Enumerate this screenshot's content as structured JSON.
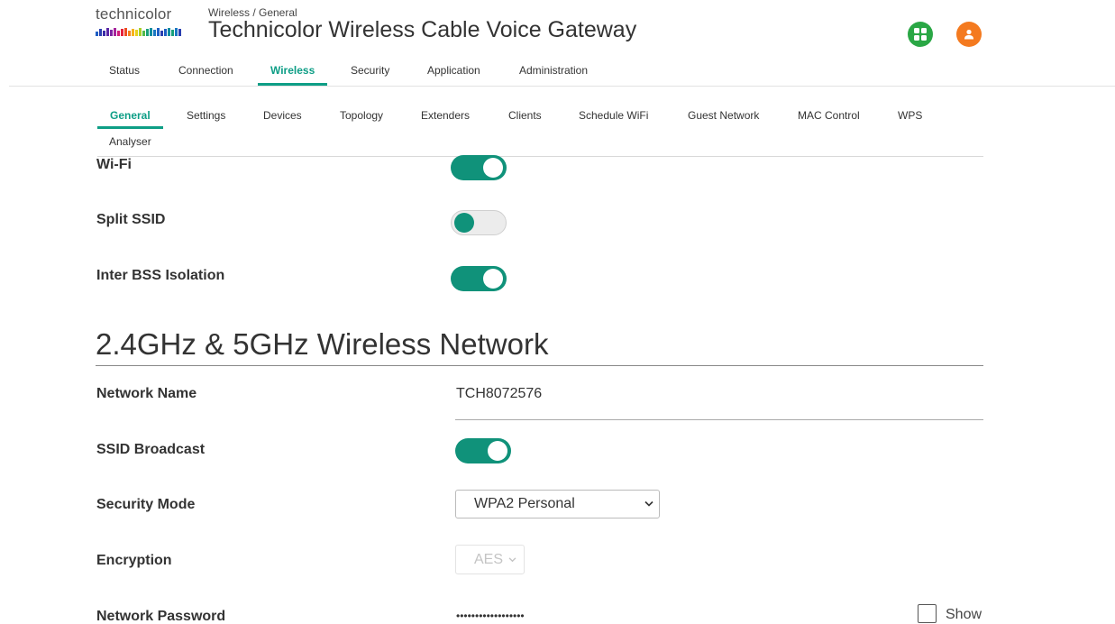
{
  "header": {
    "logo_text": "technicolor",
    "breadcrumb": "Wireless / General",
    "title": "Technicolor Wireless Cable Voice Gateway",
    "apps_icon": "apps-grid-icon",
    "user_icon": "user-icon",
    "apps_color": "#2aa745",
    "user_color": "#f47a1f"
  },
  "main_nav": {
    "tabs": [
      "Status",
      "Connection",
      "Wireless",
      "Security",
      "Application",
      "Administration"
    ],
    "active": "Wireless"
  },
  "sub_nav": {
    "tabs": [
      "General",
      "Settings",
      "Devices",
      "Topology",
      "Extenders",
      "Clients",
      "Schedule WiFi",
      "Guest Network",
      "MAC Control",
      "WPS",
      "Analyser"
    ],
    "active": "General"
  },
  "general": {
    "wifi_label": "Wi-Fi",
    "wifi_on": true,
    "split_ssid_label": "Split SSID",
    "split_ssid_on": false,
    "inter_bss_label": "Inter BSS Isolation",
    "inter_bss_on": true
  },
  "network": {
    "section_title": "2.4GHz & 5GHz Wireless Network",
    "network_name_label": "Network Name",
    "network_name_value": "TCH8072576",
    "ssid_broadcast_label": "SSID Broadcast",
    "ssid_broadcast_on": true,
    "security_mode_label": "Security Mode",
    "security_mode_value": "WPA2 Personal",
    "encryption_label": "Encryption",
    "encryption_value": "AES",
    "password_label": "Network Password",
    "password_value": "••••••••••••••••••",
    "show_label": "Show"
  },
  "colors": {
    "accent": "#0e9e86",
    "toggle_on": "#10927a"
  }
}
